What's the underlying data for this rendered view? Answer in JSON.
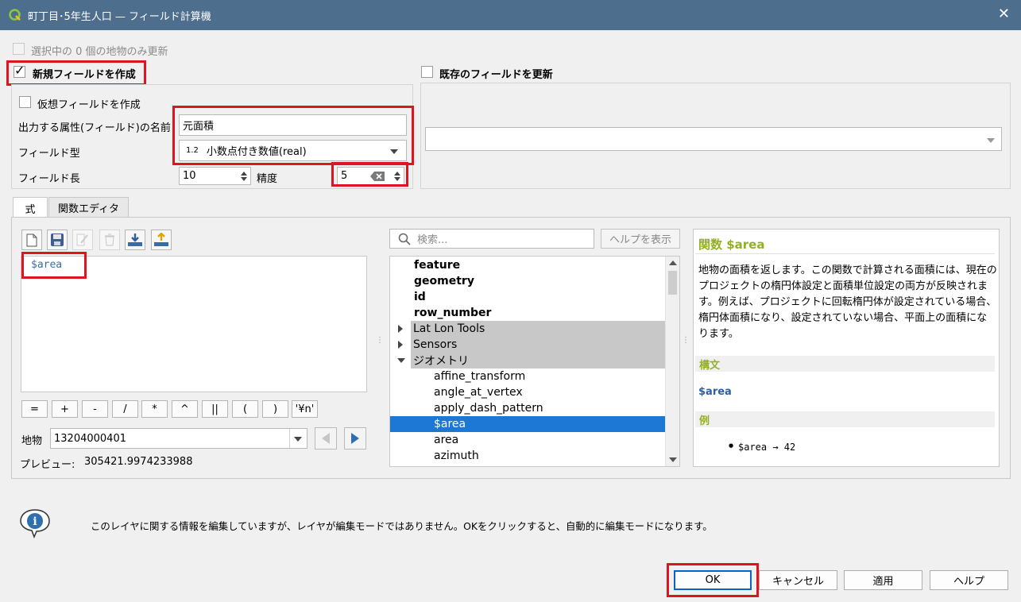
{
  "window": {
    "title": "町丁目･5年生人口 — フィールド計算機",
    "close_label": "✕"
  },
  "options": {
    "only_selected_label": "選択中の 0 個の地物のみ更新",
    "create_new_field_label": "新規フィールドを作成",
    "virtual_field_label": "仮想フィールドを作成",
    "update_existing_label": "既存のフィールドを更新"
  },
  "new_field": {
    "output_name_label": "出力する属性(フィールド)の名前",
    "output_name_value": "元面積",
    "field_type_label": "フィールド型",
    "field_type_badge": "1.2",
    "field_type_value": "小数点付き数値(real)",
    "field_length_label": "フィールド長",
    "field_length_value": "10",
    "precision_label": "精度",
    "precision_value": "5"
  },
  "tabs": [
    {
      "label": "式"
    },
    {
      "label": "関数エディタ"
    }
  ],
  "expression": {
    "code": "$area",
    "operators": [
      "=",
      "+",
      "-",
      "/",
      "*",
      "^",
      "||",
      "(",
      ")",
      "'¥n'"
    ],
    "feature_label": "地物",
    "feature_value": "13204000401",
    "preview_label": "プレビュー:",
    "preview_value": "305421.9974233988"
  },
  "search": {
    "placeholder": "検索...",
    "show_help_label": "ヘルプを表示"
  },
  "tree": {
    "items": [
      {
        "label": "feature"
      },
      {
        "label": "geometry"
      },
      {
        "label": "id"
      },
      {
        "label": "row_number"
      },
      {
        "label": "Lat Lon Tools"
      },
      {
        "label": "Sensors"
      },
      {
        "label": "ジオメトリ"
      },
      {
        "label": "affine_transform"
      },
      {
        "label": "angle_at_vertex"
      },
      {
        "label": "apply_dash_pattern"
      },
      {
        "label": "$area"
      },
      {
        "label": "area"
      },
      {
        "label": "azimuth"
      }
    ]
  },
  "help": {
    "title": "関数 $area",
    "description": "地物の面積を返します。この関数で計算される面積には、現在のプロジェクトの楕円体設定と面積単位設定の両方が反映されます。例えば、プロジェクトに回転楕円体が設定されている場合、楕円体面積になり、設定されていない場合、平面上の面積になります。",
    "syntax_header": "構文",
    "syntax": "$area",
    "examples_header": "例",
    "example_code": "$area → 42"
  },
  "message": "このレイヤに関する情報を編集していますが、レイヤが編集モードではありません。OKをクリックすると、自動的に編集モードになります。",
  "buttons": {
    "ok": "OK",
    "cancel": "キャンセル",
    "apply": "適用",
    "help": "ヘルプ"
  },
  "colors": {
    "titlebar": "#4e6e8e",
    "highlight": "#e0141e",
    "selection": "#1c78d4",
    "help_accent": "#93b023"
  }
}
